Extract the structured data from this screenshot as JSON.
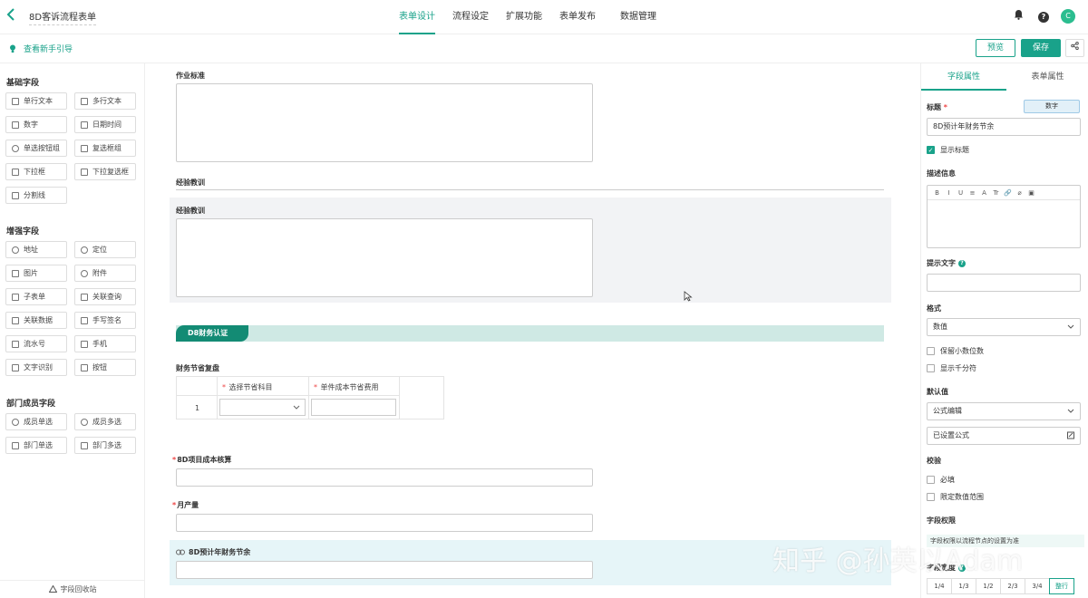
{
  "header": {
    "title": "8D客诉流程表单",
    "tabs": [
      {
        "label": "表单设计",
        "active": true
      },
      {
        "label": "流程设定",
        "active": false
      },
      {
        "label": "扩展功能",
        "active": false
      },
      {
        "label": "表单发布",
        "active": false
      },
      {
        "label": "数据管理",
        "active": false
      }
    ],
    "avatar_letter": "C",
    "help_glyph": "?"
  },
  "subbar": {
    "guide_label": "查看新手引导",
    "preview_label": "预览",
    "save_label": "保存"
  },
  "left": {
    "groups": [
      {
        "title": "基础字段",
        "items": [
          "单行文本",
          "多行文本",
          "数字",
          "日期时间",
          "单选按钮组",
          "复选框组",
          "下拉框",
          "下拉复选框",
          "分割线"
        ]
      },
      {
        "title": "增强字段",
        "items": [
          "地址",
          "定位",
          "图片",
          "附件",
          "子表单",
          "关联查询",
          "关联数据",
          "手写签名",
          "流水号",
          "手机",
          "文字识别",
          "按钮"
        ]
      },
      {
        "title": "部门成员字段",
        "items": [
          "成员单选",
          "成员多选",
          "部门单选",
          "部门多选"
        ]
      }
    ],
    "recycle_label": "字段回收站"
  },
  "canvas": {
    "field_work_standard": "作业标准",
    "divider_lessons": "经验教训",
    "field_lessons": "经验教训",
    "section_title": "D8财务认证",
    "subtable_label": "财务节省复盘",
    "subtable": {
      "columns": [
        "选择节省科目",
        "单件成本节省费用"
      ],
      "row_index": "1"
    },
    "field_cost_check": "8D项目成本核算",
    "field_monthly_output": "月产量",
    "field_annual_saving": "8D预计年财务节余"
  },
  "right": {
    "tabs": [
      "字段属性",
      "表单属性"
    ],
    "title_label": "标题",
    "type_badge": "数字",
    "title_value": "8D预计年财务节余",
    "show_title": "显示标题",
    "desc_label": "描述信息",
    "rte_tools": [
      "B",
      "I",
      "U",
      "≡",
      "A",
      "Tr",
      "🔗",
      "⌀",
      "▣"
    ],
    "hint_label": "提示文字",
    "format_label": "格式",
    "format_value": "数值",
    "keep_decimals": "保留小数位数",
    "show_thousands": "显示千分符",
    "default_label": "默认值",
    "default_mode": "公式编辑",
    "formula_set": "已设置公式",
    "validate_label": "校验",
    "required": "必填",
    "limit_range": "限定数值范围",
    "perm_label": "字段权限",
    "perm_note": "字段权限以流程节点的设置为准",
    "width_label": "字段宽度",
    "widths": [
      "1/4",
      "1/3",
      "1/2",
      "2/3",
      "3/4",
      "整行"
    ]
  },
  "watermark": "知乎 @孙英以Adam"
}
